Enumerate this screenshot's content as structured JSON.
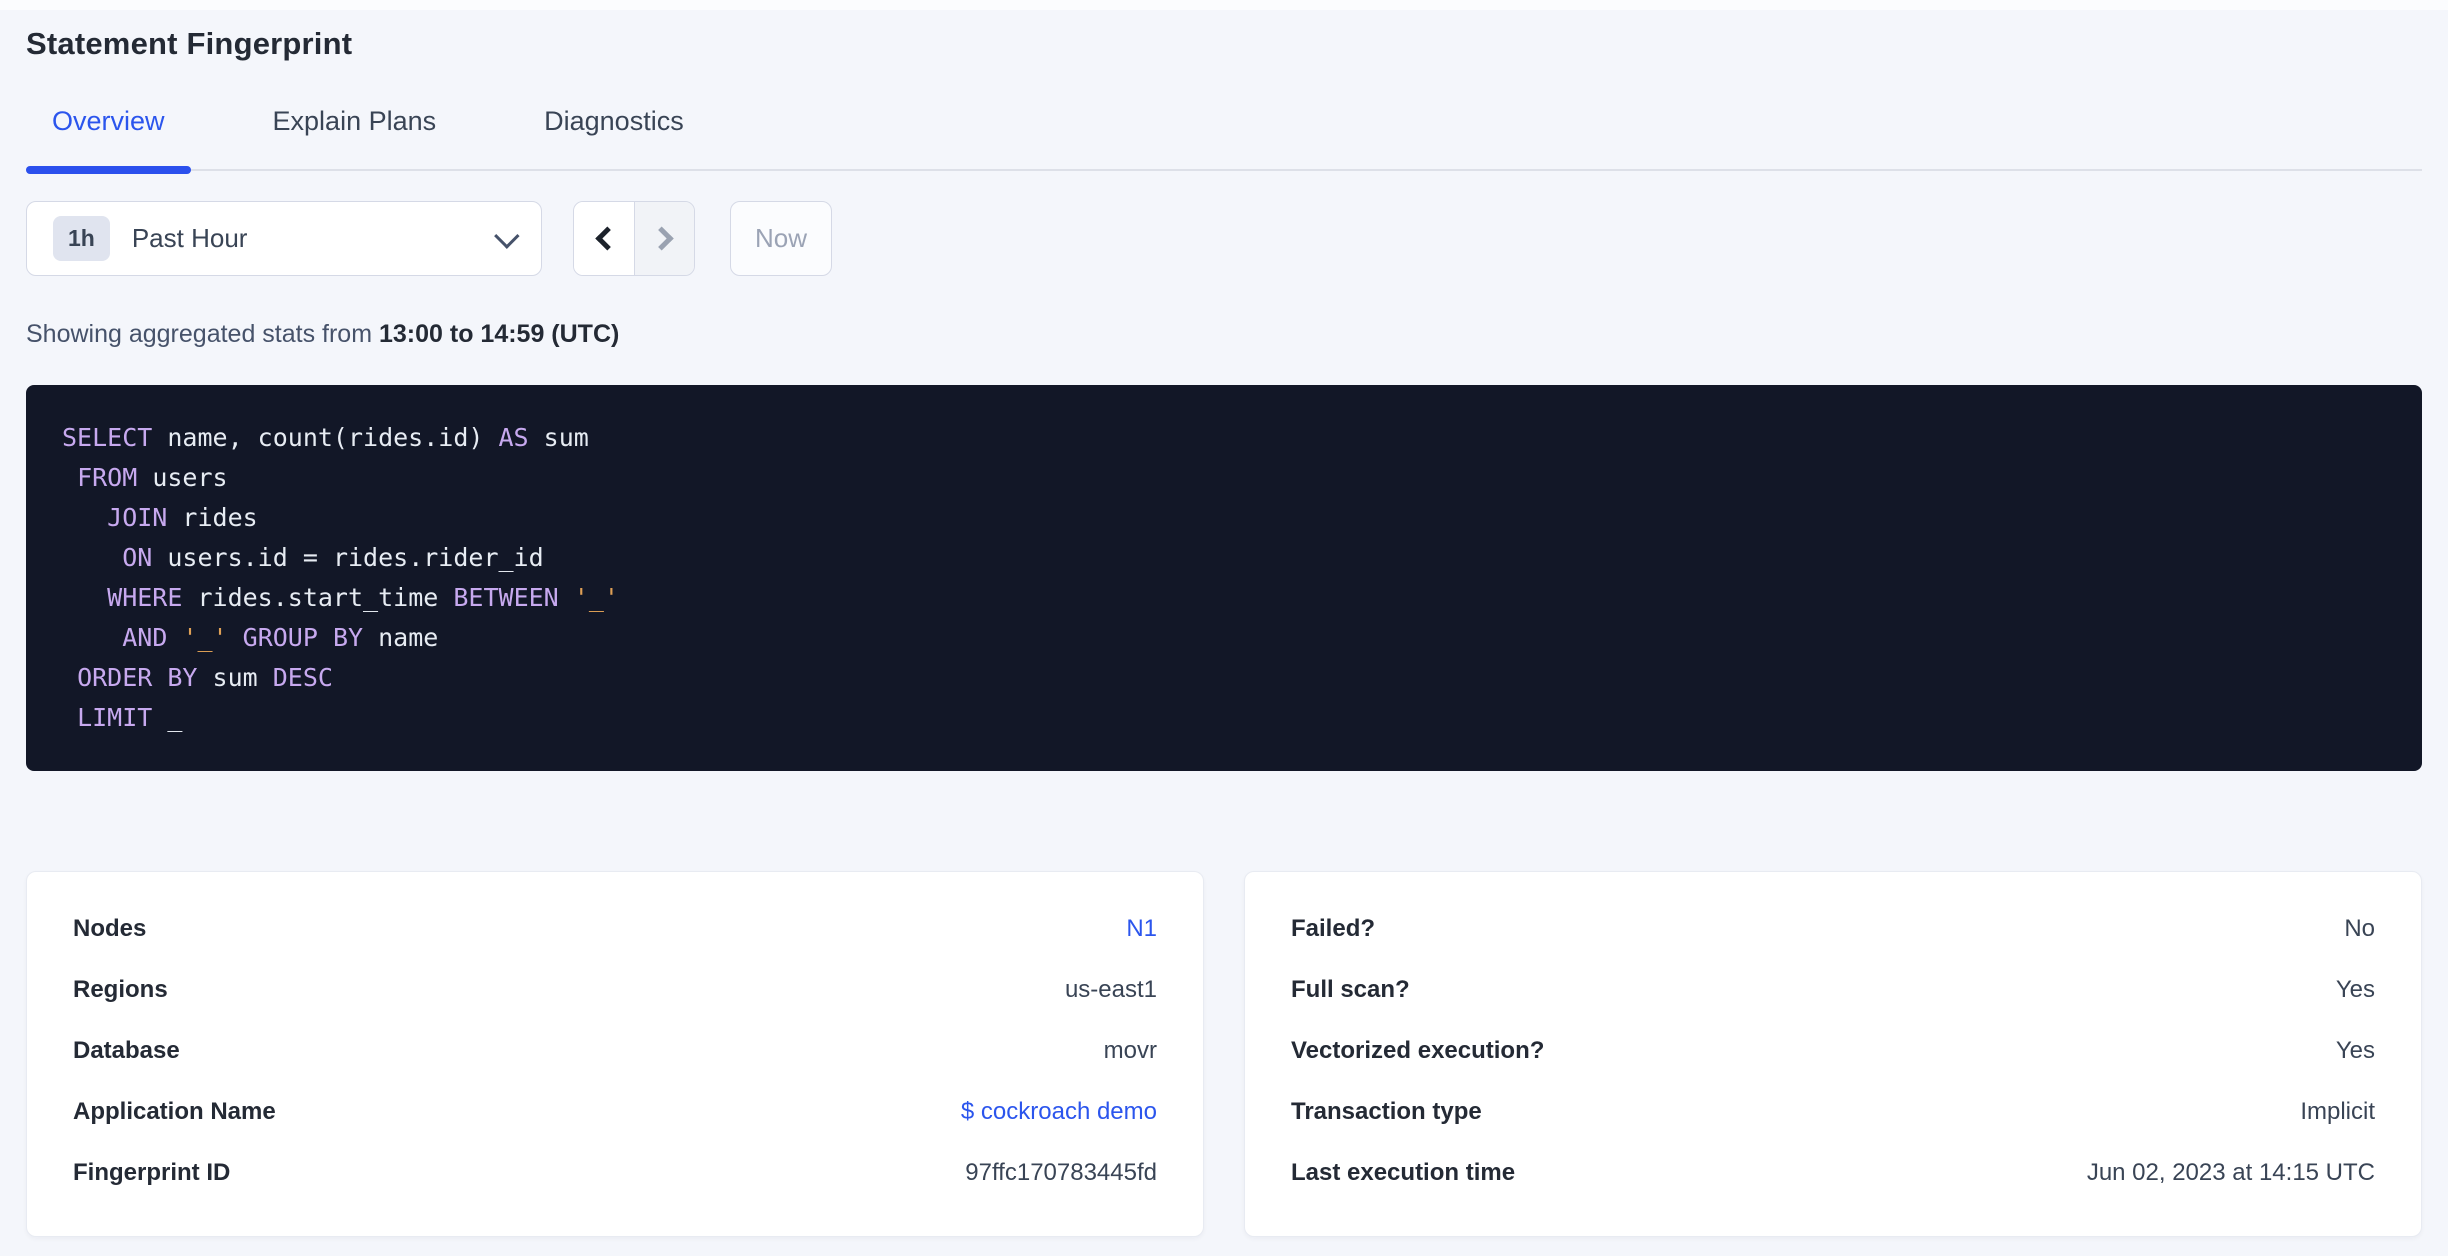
{
  "page": {
    "title": "Statement Fingerprint"
  },
  "tabs": [
    {
      "label": "Overview",
      "active": true
    },
    {
      "label": "Explain Plans",
      "active": false
    },
    {
      "label": "Diagnostics",
      "active": false
    }
  ],
  "time_controls": {
    "range_badge": "1h",
    "range_label": "Past Hour",
    "now_label": "Now",
    "prev_enabled": true,
    "next_enabled": false
  },
  "stats_line": {
    "prefix": "Showing aggregated stats from ",
    "range": "13:00 to 14:59 (UTC)"
  },
  "sql": {
    "lines": [
      [
        {
          "c": "kw",
          "t": "SELECT"
        },
        {
          "c": "pl",
          "t": " name, count(rides.id) "
        },
        {
          "c": "kw",
          "t": "AS"
        },
        {
          "c": "pl",
          "t": " sum"
        }
      ],
      [
        {
          "c": "pl",
          "t": " "
        },
        {
          "c": "kw",
          "t": "FROM"
        },
        {
          "c": "pl",
          "t": " users"
        }
      ],
      [
        {
          "c": "pl",
          "t": "   "
        },
        {
          "c": "kw",
          "t": "JOIN"
        },
        {
          "c": "pl",
          "t": " rides"
        }
      ],
      [
        {
          "c": "pl",
          "t": "    "
        },
        {
          "c": "kw",
          "t": "ON"
        },
        {
          "c": "pl",
          "t": " users.id = rides.rider_id"
        }
      ],
      [
        {
          "c": "pl",
          "t": "   "
        },
        {
          "c": "kw",
          "t": "WHERE"
        },
        {
          "c": "pl",
          "t": " rides.start_time "
        },
        {
          "c": "kw",
          "t": "BETWEEN"
        },
        {
          "c": "pl",
          "t": " "
        },
        {
          "c": "str",
          "t": "'_'"
        }
      ],
      [
        {
          "c": "pl",
          "t": "    "
        },
        {
          "c": "kw",
          "t": "AND"
        },
        {
          "c": "pl",
          "t": " "
        },
        {
          "c": "str",
          "t": "'_'"
        },
        {
          "c": "pl",
          "t": " "
        },
        {
          "c": "kw",
          "t": "GROUP BY"
        },
        {
          "c": "pl",
          "t": " name"
        }
      ],
      [
        {
          "c": "pl",
          "t": " "
        },
        {
          "c": "kw",
          "t": "ORDER BY"
        },
        {
          "c": "pl",
          "t": " sum "
        },
        {
          "c": "kw",
          "t": "DESC"
        }
      ],
      [
        {
          "c": "pl",
          "t": " "
        },
        {
          "c": "kw",
          "t": "LIMIT"
        },
        {
          "c": "pl",
          "t": " _"
        }
      ]
    ]
  },
  "cards": {
    "left": {
      "rows": [
        {
          "label": "Nodes",
          "value": "N1",
          "link": true
        },
        {
          "label": "Regions",
          "value": "us-east1",
          "link": false
        },
        {
          "label": "Database",
          "value": "movr",
          "link": false
        },
        {
          "label": "Application Name",
          "value": "$ cockroach demo",
          "link": true
        },
        {
          "label": "Fingerprint ID",
          "value": "97ffc170783445fd",
          "link": false
        }
      ]
    },
    "right": {
      "rows": [
        {
          "label": "Failed?",
          "value": "No",
          "link": false
        },
        {
          "label": "Full scan?",
          "value": "Yes",
          "link": false
        },
        {
          "label": "Vectorized execution?",
          "value": "Yes",
          "link": false
        },
        {
          "label": "Transaction type",
          "value": "Implicit",
          "link": false
        },
        {
          "label": "Last execution time",
          "value": "Jun 02, 2023 at 14:15 UTC",
          "link": false
        }
      ]
    }
  },
  "colors": {
    "accent_blue": "#2b55ed",
    "tab_underline": "#2b50ed",
    "page_background": "#f4f6fb",
    "code_background": "#121727",
    "code_keyword": "#c7a9ef",
    "code_string": "#dfa056",
    "code_text": "#e7ecf3",
    "text_dark": "#242a35",
    "text_body": "#394455",
    "disabled_text": "#9ba3b5",
    "control_border": "#d5d9e6"
  }
}
